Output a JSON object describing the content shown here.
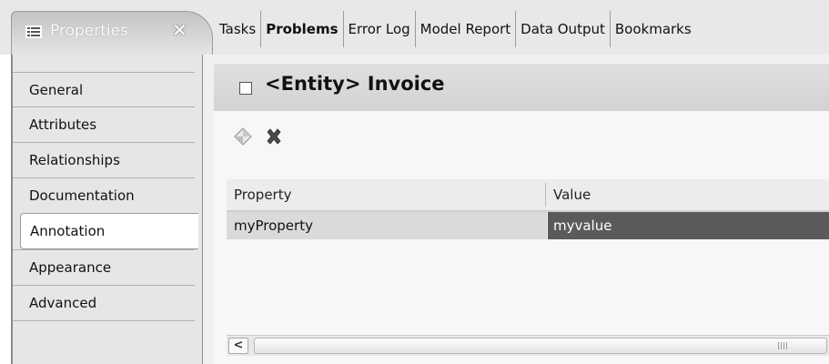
{
  "active_tab": {
    "title": "Properties",
    "icon": "list-icon",
    "close": "✕"
  },
  "tabs": [
    {
      "label": "Tasks"
    },
    {
      "label": "Problems"
    },
    {
      "label": "Error Log"
    },
    {
      "label": "Model Report"
    },
    {
      "label": "Data Output"
    },
    {
      "label": "Bookmarks"
    }
  ],
  "sidebar": {
    "items": [
      {
        "label": "General"
      },
      {
        "label": "Attributes"
      },
      {
        "label": "Relationships"
      },
      {
        "label": "Documentation"
      },
      {
        "label": "Annotation"
      },
      {
        "label": "Appearance"
      },
      {
        "label": "Advanced"
      }
    ],
    "active": "Annotation"
  },
  "header": {
    "title": "<Entity> Invoice"
  },
  "toolbar": {
    "add_icon": "add-diamond-icon",
    "delete_icon": "delete-x-icon"
  },
  "table": {
    "columns": [
      "Property",
      "Value"
    ],
    "rows": [
      {
        "property": "myProperty",
        "value": "myvalue"
      }
    ]
  },
  "colors": {
    "selected_cell": "#5a5a5a",
    "row_highlight": "#dadada"
  }
}
